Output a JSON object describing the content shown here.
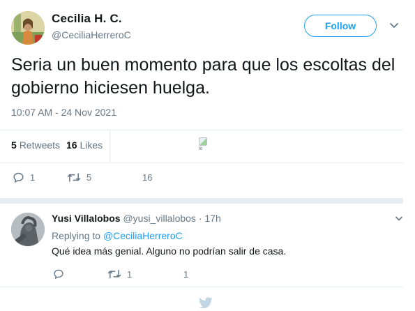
{
  "author": {
    "name": "Cecilia H. C.",
    "handle": "@CeciliaHerreroC"
  },
  "follow_label": "Follow",
  "tweet": {
    "text": "Seria un buen momento para que los escoltas del gobierno hiciesen huelga.",
    "timestamp": "10:07 AM - 24 Nov 2021"
  },
  "stats": {
    "retweets_count": "5",
    "retweets_label": "Retweets",
    "likes_count": "16",
    "likes_label": "Likes",
    "broken_image_alt": "lo"
  },
  "actions": {
    "reply_count": "1",
    "retweet_count": "5",
    "like_count": "16"
  },
  "reply": {
    "name": "Yusi Villalobos",
    "handle": "@yusi_villalobos",
    "separator": "·",
    "time": "17h",
    "replying_prefix": "Replying to",
    "replying_to": "@CeciliaHerreroC",
    "text": "Qué idea más genial. Alguno no podrían salir de casa.",
    "actions": {
      "reply_count": "",
      "retweet_count": "1",
      "like_count": "1"
    }
  },
  "colors": {
    "accent": "#1da1f2",
    "muted": "#657786",
    "divider": "#e6ecf0",
    "text": "#14171a"
  }
}
